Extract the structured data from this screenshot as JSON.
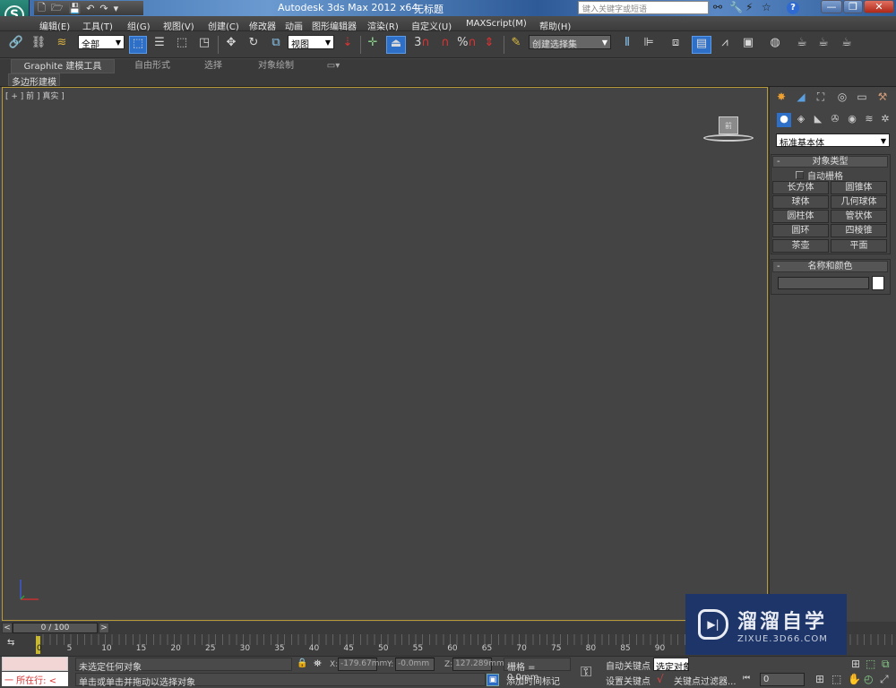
{
  "app": {
    "title": "Autodesk 3ds Max  2012 x64",
    "document": "无标题",
    "logo_glyph": "S"
  },
  "quick_access": [
    "new-icon",
    "open-icon",
    "save-icon",
    "undo-icon",
    "redo-icon",
    "customize-dropdown-icon"
  ],
  "quick_access_glyphs": [
    "🗋",
    "🗁",
    "💾",
    "↶",
    "↷",
    "▾"
  ],
  "search": {
    "placeholder": "键入关键字或短语"
  },
  "title_icons": {
    "binoculars": "⚯",
    "wrench": "🔧",
    "satellite": "⚡",
    "star": "☆",
    "help": "?"
  },
  "window_buttons": {
    "minimize": "—",
    "restore": "❐",
    "close": "✕"
  },
  "menu": [
    "编辑(E)",
    "工具(T)",
    "组(G)",
    "视图(V)",
    "创建(C)",
    "修改器",
    "动画",
    "图形编辑器",
    "渲染(R)",
    "自定义(U)",
    "MAXScript(M)",
    "帮助(H)"
  ],
  "toolbar": {
    "filter_dropdown": "全部",
    "refcoord_dropdown": "视图",
    "named_selection_dropdown": "创建选择集",
    "snap_3d_label": "3",
    "percent_snap_label": "%"
  },
  "ribbon": {
    "tabs": [
      "Graphite 建模工具",
      "自由形式",
      "选择",
      "对象绘制"
    ],
    "active_tab": 0,
    "sub_tab": "多边形建模"
  },
  "viewport": {
    "label": "[ + ] 前 ] 真实 ]",
    "viewcube_face": "前"
  },
  "command_panel": {
    "tab_glyphs": [
      "✸",
      "◢",
      "⛶",
      "◎",
      "▭",
      "⚒"
    ],
    "subtab_glyphs": [
      "●",
      "◈",
      "◣",
      "✇",
      "◉",
      "≋",
      "✲"
    ],
    "category_dropdown": "标准基本体",
    "object_type": {
      "title": "对象类型",
      "autogrid_label": "自动栅格",
      "autogrid_checked": false,
      "buttons": [
        "长方体",
        "圆锥体",
        "球体",
        "几何球体",
        "圆柱体",
        "管状体",
        "圆环",
        "四棱锥",
        "茶壶",
        "平面"
      ]
    },
    "name_color": {
      "title": "名称和颜色",
      "name_value": "",
      "color": "#ffffff"
    }
  },
  "time_slider": {
    "value": "0 / 100",
    "current_frame": 0,
    "total_frames": 100,
    "prev": "<",
    "next": ">"
  },
  "trackbar": {
    "tick_labels": [
      "0",
      "5",
      "10",
      "15",
      "20",
      "25",
      "30",
      "35",
      "40",
      "45",
      "50",
      "55",
      "60",
      "65",
      "70",
      "75",
      "80",
      "85",
      "90"
    ]
  },
  "status": {
    "macro_recorder": "一  所在行:  <",
    "selection_status": "未选定任何对象",
    "prompt": "单击或单击并拖动以选择对象",
    "x_label": "X:",
    "x_value": "-179.67mm",
    "y_label": "Y:",
    "y_value": "-0.0mm",
    "z_label": "Z:",
    "z_value": "127.289mm",
    "grid": "栅格 = 0.0mm",
    "add_time_tag": "添加时间标记",
    "auto_key": "自动关键点",
    "set_key": "设置关键点",
    "selected_set": "选定对象",
    "key_filters": "关键点过滤器...",
    "frame_value": "0"
  },
  "watermark": {
    "title": "溜溜自学",
    "url": "ZIXUE.3D66.COM"
  }
}
